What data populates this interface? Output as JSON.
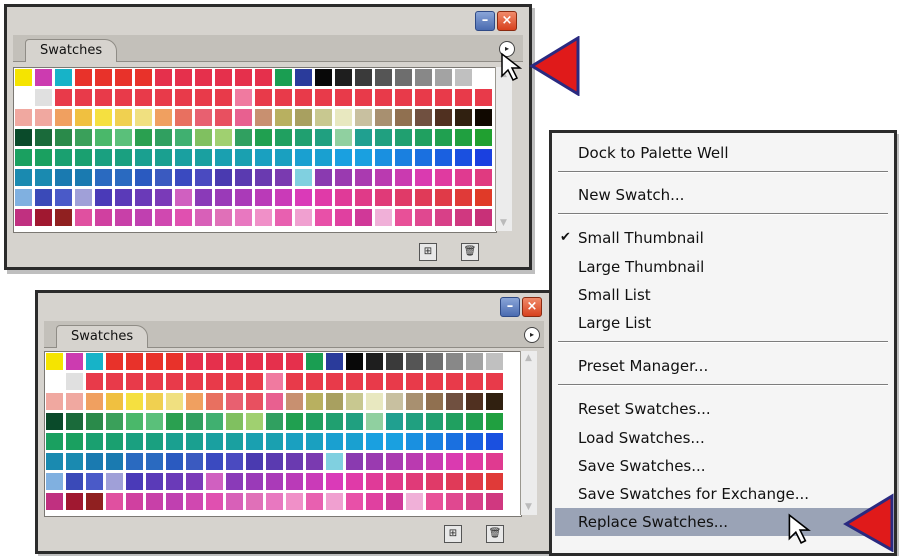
{
  "palette": {
    "tab_label": "Swatches",
    "menu_button": "▸",
    "minimize_icon": "minimize-icon",
    "close_icon": "close-icon",
    "new_swatch_icon": "new-swatch-icon",
    "trash_icon": "trash-icon"
  },
  "menu": {
    "items": [
      {
        "label": "Dock to Palette Well"
      },
      {
        "label": "New Swatch..."
      },
      {
        "label": "Small Thumbnail",
        "checked": true
      },
      {
        "label": "Large Thumbnail"
      },
      {
        "label": "Small List"
      },
      {
        "label": "Large List"
      },
      {
        "label": "Preset Manager..."
      },
      {
        "label": "Reset Swatches..."
      },
      {
        "label": "Load Swatches..."
      },
      {
        "label": "Save Swatches..."
      },
      {
        "label": "Save Swatches for Exchange..."
      },
      {
        "label": "Replace Swatches...",
        "highlighted": true
      }
    ]
  },
  "swatch_rows": [
    [
      "#f5e400",
      "#cc3bb0",
      "#17b3c8",
      "#e8322a",
      "#e8322a",
      "#e8322a",
      "#e8322a",
      "#e5304c",
      "#e5304c",
      "#e5304c",
      "#e5304c",
      "#e5304c",
      "#e5304c",
      "#1a9e52",
      "#2a3b9b",
      "#080808",
      "#1e1e1e",
      "#3a3a3a",
      "#555555",
      "#6e6e6e",
      "#888888",
      "#a3a3a3",
      "#c0c0c0",
      "#ffffff"
    ],
    [
      "#ffffff",
      "#e0e0e0",
      "#e83a4a",
      "#e83a4a",
      "#e83a4a",
      "#e83a4a",
      "#e83a4a",
      "#e83a4a",
      "#e83a4a",
      "#e83a4a",
      "#e83a4a",
      "#f07aa0",
      "#e83a4a",
      "#e83a4a",
      "#e83a4a",
      "#e83a4a",
      "#e83a4a",
      "#e83a4a",
      "#e83a4a",
      "#e83a4a",
      "#e83a4a",
      "#e83a4a",
      "#e83a4a",
      "#e83a4a"
    ],
    [
      "#f0a8a0",
      "#f0a8a0",
      "#f0a060",
      "#f0c040",
      "#f5e040",
      "#f0d050",
      "#f0e080",
      "#f0a060",
      "#e87060",
      "#e86070",
      "#e85060",
      "#e86090",
      "#c89070",
      "#b8b060",
      "#a8a060",
      "#c8c890",
      "#e8e8c0",
      "#c8c0a0",
      "#a89070",
      "#907050",
      "#705040",
      "#503020",
      "#302010",
      "#100800"
    ],
    [
      "#0a4a2a",
      "#1a6a3a",
      "#2a8a4a",
      "#3aa05a",
      "#4ab86a",
      "#5ac07a",
      "#2aa050",
      "#30a060",
      "#40b070",
      "#80c060",
      "#a0d070",
      "#30a060",
      "#20a050",
      "#20a060",
      "#20a070",
      "#20a080",
      "#90d0a0",
      "#20a090",
      "#20a080",
      "#20a070",
      "#20a060",
      "#20a050",
      "#20a040",
      "#20a030"
    ],
    [
      "#1aa060",
      "#1aa060",
      "#1aa070",
      "#1aa070",
      "#1aa080",
      "#1aa080",
      "#1aa090",
      "#1aa090",
      "#1aa0a0",
      "#1aa0a0",
      "#1aa0b0",
      "#1aa0b0",
      "#1aa0c0",
      "#1aa0c0",
      "#1aa0d0",
      "#1aa0d0",
      "#1aa0e0",
      "#1aa0e0",
      "#1a90e0",
      "#1a80e0",
      "#1a70e0",
      "#1a60e0",
      "#1a50e0",
      "#1a40e0"
    ],
    [
      "#1a8ab0",
      "#1a8ab0",
      "#1a7ab0",
      "#1a7ab0",
      "#2a6ac0",
      "#2a6ac0",
      "#2a5ac0",
      "#3a5ac0",
      "#3a4ac0",
      "#4a4ac0",
      "#4a3ab0",
      "#5a3ab0",
      "#6a3ab0",
      "#7a3ab0",
      "#80d0e0",
      "#8a3ab0",
      "#9a3ab0",
      "#aa3ab0",
      "#ba3ab0",
      "#ca3ab0",
      "#da3ab0",
      "#e03aa0",
      "#e03a90",
      "#e03a80"
    ],
    [
      "#80b0e0",
      "#3a4ab8",
      "#4a5ac8",
      "#a0a0d8",
      "#4a3ab8",
      "#5a3ab8",
      "#6a3ab8",
      "#7a3ab8",
      "#d060c0",
      "#8a3ab8",
      "#9a3ab8",
      "#aa3ab8",
      "#ba3ab8",
      "#ca3ab8",
      "#da3ab8",
      "#e03aa8",
      "#e03a98",
      "#e03a88",
      "#e03a78",
      "#e03a68",
      "#e03a58",
      "#e03a48",
      "#e03a38",
      "#e03a28"
    ],
    [
      "#c03080",
      "#a01830",
      "#902020",
      "#e050a0",
      "#d040a0",
      "#c840a8",
      "#c040b0",
      "#d048b0",
      "#e050b0",
      "#d860b8",
      "#e070b8",
      "#e878c0",
      "#f090c8",
      "#e860b0",
      "#f0a0d0",
      "#e850a8",
      "#e040a0",
      "#d03898",
      "#f0b0d8",
      "#e85098",
      "#e04890",
      "#d84088",
      "#d03880",
      "#c83078"
    ]
  ]
}
